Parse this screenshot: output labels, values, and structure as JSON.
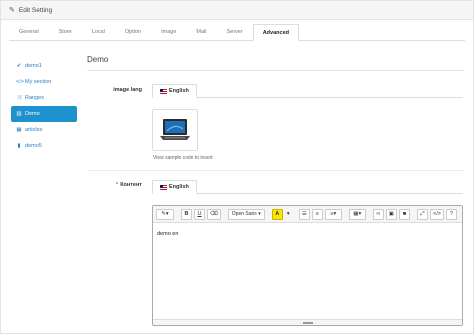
{
  "header": {
    "title": "Edit Setting",
    "icon": "pencil-icon"
  },
  "tabs": [
    {
      "label": "General",
      "active": false
    },
    {
      "label": "Store",
      "active": false
    },
    {
      "label": "Local",
      "active": false
    },
    {
      "label": "Option",
      "active": false
    },
    {
      "label": "Image",
      "active": false
    },
    {
      "label": "Mail",
      "active": false
    },
    {
      "label": "Server",
      "active": false
    },
    {
      "label": "Advanced",
      "active": true
    }
  ],
  "sidebar": {
    "items": [
      {
        "label": "demo1",
        "icon": "check-icon",
        "glyph": "✔",
        "active": false
      },
      {
        "label": "My section",
        "icon": "code-icon",
        "glyph": "</>",
        "active": false
      },
      {
        "label": "Ranges",
        "icon": "random-icon",
        "glyph": "⤨",
        "active": false
      },
      {
        "label": "Demo",
        "icon": "bar-chart-icon",
        "glyph": "▥",
        "active": true
      },
      {
        "label": "articles",
        "icon": "table-icon",
        "glyph": "▦",
        "active": false
      },
      {
        "label": "demo5",
        "icon": "bookmark-icon",
        "glyph": "▮",
        "active": false
      }
    ]
  },
  "content": {
    "legend": "Demo",
    "image_field": {
      "label": "image lang",
      "lang_tab": "English",
      "hint": "View sample code to insert"
    },
    "content_field": {
      "label": "Контент",
      "required_mark": "*",
      "lang_tab": "English",
      "editor_text": "demo en",
      "font_name": "Open Sans"
    }
  },
  "colors": {
    "accent": "#1e91cf",
    "link": "#2a7fc9",
    "required": "#e3503e",
    "highlight": "#ffe600"
  }
}
